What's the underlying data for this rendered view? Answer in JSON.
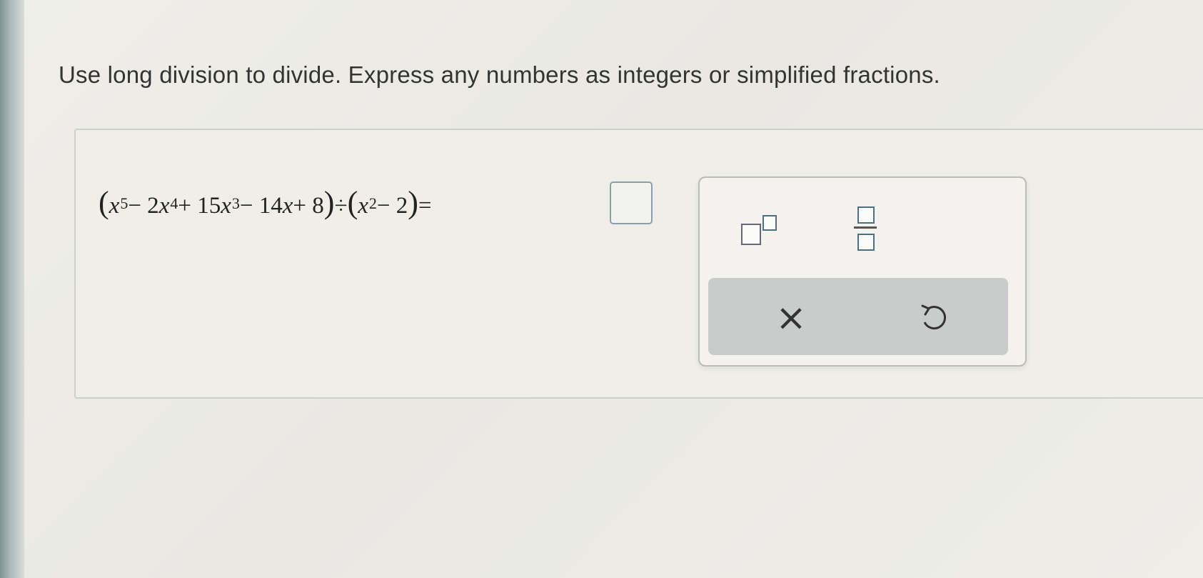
{
  "instruction": "Use long division to divide. Express any numbers as integers or simplified fractions.",
  "equation": {
    "open_paren": "(",
    "t1_var": "x",
    "t1_exp": "5",
    "op1": " − 2",
    "t2_var": "x",
    "t2_exp": "4",
    "op2": " + 15",
    "t3_var": "x",
    "t3_exp": "3",
    "op3": " − 14",
    "t4_var": "x",
    "op4": " + 8",
    "close_paren": ")",
    "divide": " ÷ ",
    "open_paren2": "(",
    "d_var": "x",
    "d_exp": "2",
    "d_op": " − 2",
    "close_paren2": ")",
    "equals": " = "
  },
  "answer": {
    "value": ""
  },
  "palette": {
    "exponent_icon": "superscript-template-icon",
    "fraction_icon": "fraction-template-icon",
    "clear_label": "×",
    "undo_icon": "undo-icon"
  },
  "colors": {
    "answer_border": "#8aa0a7",
    "action_bar": "#c9cccb",
    "background": "#ecebe6"
  }
}
